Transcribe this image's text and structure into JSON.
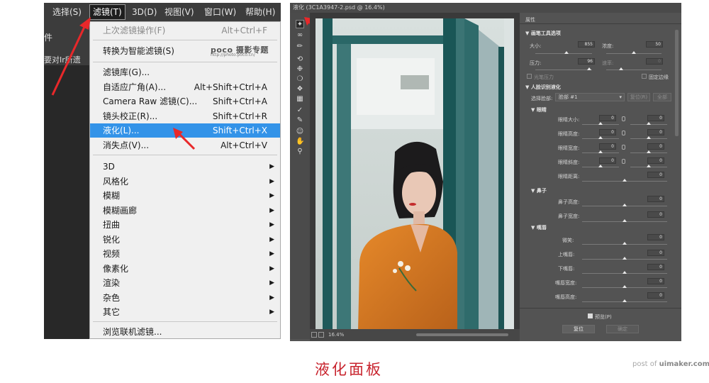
{
  "menubar": {
    "items": [
      "选择(S)",
      "滤镜(T)",
      "3D(D)",
      "视图(V)",
      "窗口(W)",
      "帮助(H)"
    ],
    "active": "滤镜(T)"
  },
  "ps": {
    "optbar_text": "件",
    "doctab_text": "要对Ir所遗",
    "poco_logo": "poco 摄影专题",
    "poco_url": "http://photo.poco.cn/"
  },
  "filter_menu": {
    "items": [
      {
        "label": "上次滤镜操作(F)",
        "shortcut": "Alt+Ctrl+F",
        "disabled": true
      },
      {
        "label": "转换为智能滤镜(S)",
        "shortcut": ""
      },
      {
        "label": "滤镜库(G)...",
        "shortcut": ""
      },
      {
        "label": "自适应广角(A)...",
        "shortcut": "Alt+Shift+Ctrl+A"
      },
      {
        "label": "Camera Raw 滤镜(C)...",
        "shortcut": "Shift+Ctrl+A"
      },
      {
        "label": "镜头校正(R)...",
        "shortcut": "Shift+Ctrl+R"
      },
      {
        "label": "液化(L)...",
        "shortcut": "Shift+Ctrl+X",
        "highlighted": true
      },
      {
        "label": "消失点(V)...",
        "shortcut": "Alt+Ctrl+V"
      },
      {
        "label": "3D",
        "submenu": true
      },
      {
        "label": "风格化",
        "submenu": true
      },
      {
        "label": "模糊",
        "submenu": true
      },
      {
        "label": "模糊画廊",
        "submenu": true
      },
      {
        "label": "扭曲",
        "submenu": true
      },
      {
        "label": "锐化",
        "submenu": true
      },
      {
        "label": "视频",
        "submenu": true
      },
      {
        "label": "像素化",
        "submenu": true
      },
      {
        "label": "渲染",
        "submenu": true
      },
      {
        "label": "杂色",
        "submenu": true
      },
      {
        "label": "其它",
        "submenu": true
      },
      {
        "label": "浏览联机滤镜...",
        "shortcut": ""
      }
    ],
    "highlight_color": "#3393e8"
  },
  "liquify": {
    "title": "液化 (3C1A3947-2.psd @ 16.4%)",
    "zoom": "16.4%",
    "properties_title": "属性",
    "brush_section": "画笔工具选项",
    "brush": {
      "size_label": "大小:",
      "size_value": "855",
      "density_label": "浓度:",
      "density_value": "50",
      "pressure_label": "压力:",
      "pressure_value": "96",
      "rate_label": "速率:",
      "rate_value": "0",
      "stylus_label": "光笔压力",
      "pin_edges_label": "固定边缘"
    },
    "face_section": "人脸识别液化",
    "select_face_label": "选择脸部:",
    "select_face_value": "脸部 #1",
    "reset_label": "复位(R)",
    "all_label": "全部",
    "eyes_section": "眼睛",
    "eye_rows": [
      "眼睛大小:",
      "眼睛高度:",
      "眼睛宽度:",
      "眼睛斜度:",
      "眼睛距离:"
    ],
    "eye_values": [
      "0",
      "0",
      "0",
      "0",
      "0"
    ],
    "nose_section": "鼻子",
    "nose_rows": [
      "鼻子高度:",
      "鼻子宽度:"
    ],
    "nose_values": [
      "0",
      "0"
    ],
    "mouth_section": "嘴唇",
    "mouth_rows": [
      "微笑:",
      "上嘴唇:",
      "下嘴唇:",
      "嘴唇宽度:",
      "嘴唇高度:"
    ],
    "mouth_values": [
      "0",
      "0",
      "0",
      "0",
      "0"
    ],
    "preview_label": "预览(P)",
    "ok_label": "复位",
    "cancel_label": "确定"
  },
  "caption": "液化面板",
  "watermark": {
    "prefix": "post of ",
    "site": "uimaker.com"
  },
  "colors": {
    "arrow": "#e8282a",
    "caption": "#c8242e",
    "ps_dark": "#3c3c3c",
    "panel": "#535353"
  }
}
